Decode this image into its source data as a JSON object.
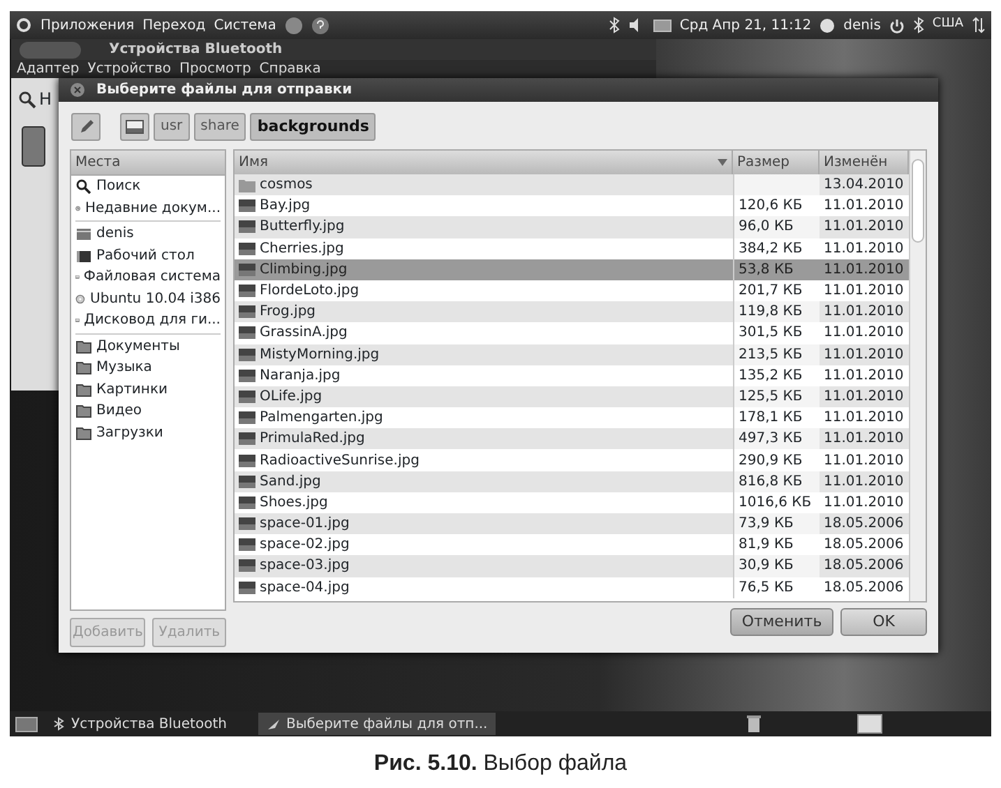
{
  "top_panel": {
    "menus": [
      "Приложения",
      "Переход",
      "Система"
    ],
    "clock": "Срд Апр 21, 11:12",
    "user": "denis",
    "keyboard": "США"
  },
  "background_window": {
    "title": "Устройства Bluetooth",
    "menus": [
      "Адаптер",
      "Устройство",
      "Просмотр",
      "Справка"
    ],
    "search_text": "Н"
  },
  "dialog": {
    "title": "Выберите файлы для отправки",
    "path": [
      {
        "label": "usr",
        "selected": false
      },
      {
        "label": "share",
        "selected": false
      },
      {
        "label": "backgrounds",
        "selected": true
      }
    ],
    "places": {
      "header": "Места",
      "groups": [
        [
          {
            "label": "Поиск",
            "kind": "search"
          },
          {
            "label": "Недавние докум...",
            "kind": "recent"
          }
        ],
        [
          {
            "label": "denis",
            "kind": "home"
          },
          {
            "label": "Рабочий стол",
            "kind": "desktop"
          },
          {
            "label": "Файловая система",
            "kind": "drive"
          },
          {
            "label": "Ubuntu 10.04 i386",
            "kind": "disc"
          },
          {
            "label": "Дисковод для ги...",
            "kind": "drive"
          }
        ],
        [
          {
            "label": "Документы",
            "kind": "folder"
          },
          {
            "label": "Музыка",
            "kind": "folder"
          },
          {
            "label": "Картинки",
            "kind": "folder"
          },
          {
            "label": "Видео",
            "kind": "folder"
          },
          {
            "label": "Загрузки",
            "kind": "folder"
          }
        ]
      ]
    },
    "place_buttons": [
      {
        "label": "Добавить",
        "disabled": true
      },
      {
        "label": "Удалить",
        "disabled": true
      }
    ],
    "columns": [
      {
        "label": "Имя",
        "sorted": true
      },
      {
        "label": "Размер",
        "sorted": false
      },
      {
        "label": "Изменён",
        "sorted": false
      }
    ],
    "rows": [
      {
        "name": "cosmos",
        "size": "",
        "modified": "13.04.2010",
        "kind": "folder",
        "selected": false
      },
      {
        "name": "Bay.jpg",
        "size": "120,6 КБ",
        "modified": "11.01.2010",
        "kind": "image",
        "selected": false
      },
      {
        "name": "Butterfly.jpg",
        "size": "96,0 КБ",
        "modified": "11.01.2010",
        "kind": "image",
        "selected": false
      },
      {
        "name": "Cherries.jpg",
        "size": "384,2 КБ",
        "modified": "11.01.2010",
        "kind": "image",
        "selected": false
      },
      {
        "name": "Climbing.jpg",
        "size": "53,8 КБ",
        "modified": "11.01.2010",
        "kind": "image",
        "selected": true
      },
      {
        "name": "FlordeLoto.jpg",
        "size": "201,7 КБ",
        "modified": "11.01.2010",
        "kind": "image",
        "selected": false
      },
      {
        "name": "Frog.jpg",
        "size": "119,8 КБ",
        "modified": "11.01.2010",
        "kind": "image",
        "selected": false
      },
      {
        "name": "GrassinA.jpg",
        "size": "301,5 КБ",
        "modified": "11.01.2010",
        "kind": "image",
        "selected": false
      },
      {
        "name": "MistyMorning.jpg",
        "size": "213,5 КБ",
        "modified": "11.01.2010",
        "kind": "image",
        "selected": false
      },
      {
        "name": "Naranja.jpg",
        "size": "135,2 КБ",
        "modified": "11.01.2010",
        "kind": "image",
        "selected": false
      },
      {
        "name": "OLife.jpg",
        "size": "125,5 КБ",
        "modified": "11.01.2010",
        "kind": "image",
        "selected": false
      },
      {
        "name": "Palmengarten.jpg",
        "size": "178,1 КБ",
        "modified": "11.01.2010",
        "kind": "image",
        "selected": false
      },
      {
        "name": "PrimulaRed.jpg",
        "size": "497,3 КБ",
        "modified": "11.01.2010",
        "kind": "image",
        "selected": false
      },
      {
        "name": "RadioactiveSunrise.jpg",
        "size": "290,9 КБ",
        "modified": "11.01.2010",
        "kind": "image",
        "selected": false
      },
      {
        "name": "Sand.jpg",
        "size": "816,8 КБ",
        "modified": "11.01.2010",
        "kind": "image",
        "selected": false
      },
      {
        "name": "Shoes.jpg",
        "size": "1016,6 КБ",
        "modified": "11.01.2010",
        "kind": "image",
        "selected": false
      },
      {
        "name": "space-01.jpg",
        "size": "73,9 КБ",
        "modified": "18.05.2006",
        "kind": "image",
        "selected": false
      },
      {
        "name": "space-02.jpg",
        "size": "81,9 КБ",
        "modified": "18.05.2006",
        "kind": "image",
        "selected": false
      },
      {
        "name": "space-03.jpg",
        "size": "30,9 КБ",
        "modified": "18.05.2006",
        "kind": "image",
        "selected": false
      },
      {
        "name": "space-04.jpg",
        "size": "76,5 КБ",
        "modified": "18.05.2006",
        "kind": "image",
        "selected": false
      }
    ],
    "buttons": [
      "Отменить",
      "OK"
    ]
  },
  "taskbar": {
    "items": [
      {
        "label": "Устройства Bluetooth",
        "selected": false
      },
      {
        "label": "Выберите файлы для отп...",
        "selected": true
      }
    ]
  },
  "caption": "**Рис. 5.10.** Выбор файла"
}
